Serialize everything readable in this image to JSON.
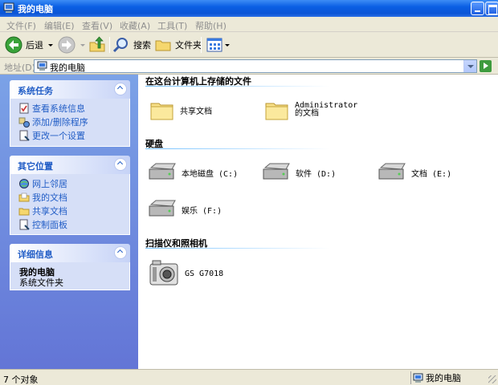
{
  "window": {
    "title": "我的电脑",
    "minimize_icon": "minimize-icon",
    "maximize_icon": "maximize-icon"
  },
  "menu": [
    "文件(F)",
    "编辑(E)",
    "查看(V)",
    "收藏(A)",
    "工具(T)",
    "帮助(H)"
  ],
  "toolbar": {
    "back_label": "后退",
    "search_label": "搜索",
    "folders_label": "文件夹"
  },
  "address": {
    "label": "地址(D)",
    "value": "我的电脑",
    "go_label": "转到"
  },
  "tasks": {
    "system": {
      "title": "系统任务",
      "items": [
        "查看系统信息",
        "添加/删除程序",
        "更改一个设置"
      ]
    },
    "places": {
      "title": "其它位置",
      "items": [
        "网上邻居",
        "我的文档",
        "共享文档",
        "控制面板"
      ]
    },
    "details": {
      "title": "详细信息",
      "name": "我的电脑",
      "type": "系统文件夹"
    }
  },
  "groups": {
    "files": {
      "title": "在这台计算机上存储的文件",
      "items": [
        "共享文档",
        "Administrator 的文档"
      ]
    },
    "drives": {
      "title": "硬盘",
      "items": [
        "本地磁盘 (C:)",
        "软件 (D:)",
        "文档 (E:)",
        "娱乐 (F:)"
      ]
    },
    "scanners": {
      "title": "扫描仪和照相机",
      "items": [
        "GS G7018"
      ]
    }
  },
  "status": {
    "count": "7 个对象",
    "location": "我的电脑"
  },
  "colors": {
    "accent_blue": "#215dc6",
    "titlebar_blue": "#0a5fe4",
    "pane_blue": "#7ba2e7",
    "chrome": "#ece9d8"
  }
}
